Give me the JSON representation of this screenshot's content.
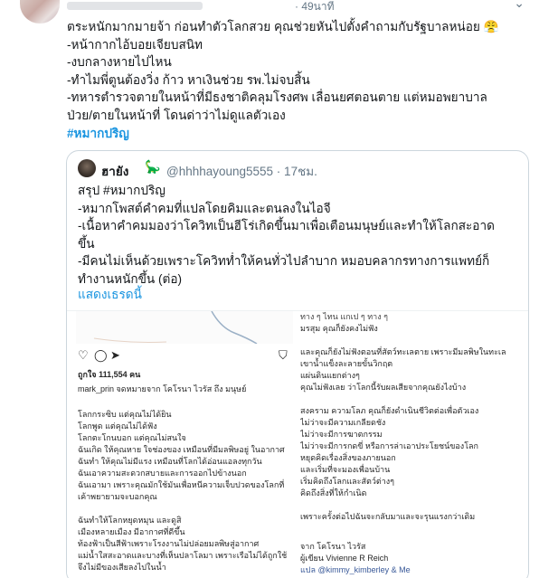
{
  "tweet": {
    "meta": "· 49นาที",
    "menu": "⌄",
    "lines": [
      "ตระหนักมากมายจ้า ก่อนทำตัวโลกสวย คุณช่วยหันไปตั้งคำถามกับรัฐบาลหน่อย 😤",
      "-หน้ากากไอ้บอยเจียบสนิท",
      "-งบกลางหายไปไหน",
      "-ทำไมพี่ตูนต้องวิ่ง ก้าว หาเงินช่วย รพ.ไม่จบสิ้น",
      "-ทหารตำรวจตายในหน้าที่มีธงชาติคลุมโรงศพ เลื่อนยศตอนตาย แต่หมอพยาบาล",
      "ป่วย/ตายในหน้าที่ โดนด่าว่าไม่ดูแลตัวเอง"
    ],
    "hashtag": "#หมากปริญ"
  },
  "quote": {
    "name": "ฮายัง",
    "emoji": "🦕",
    "handle_time": "@hhhhayoung5555 · 17ชม.",
    "lines": [
      "สรุป #หมากปริญ",
      "-หมากโพสต์คำคมที่แปลโดยคิมและตนลงในไอจี",
      "-เนื้อหาคำคมมองว่าโควิทเป็นฮีโร่เกิดขึ้นมาเพื่อเตือนมนุษย์และทำให้โลกสะอาด",
      "ขึ้น",
      "-มีคนไม่เห็นด้วยเพราะโควิทท่ำให้คนทั่วไปลำบาก หมอบคลากรทางการแพทย์ก็",
      "ทำงานหนักขึ้น (ต่อ)"
    ],
    "show_thread": "แสดงเธรดนี้"
  },
  "screenshot": {
    "likes": "ถูกใจ 111,554 คน",
    "by": "mark_prin จดหมายจาก โคโรนา ไวรัส ถึง มนุษย์",
    "poem_left": [
      "โลกกระซิบ แต่คุณไม่ได้ยิน",
      "โลกพูด แต่คุณไม่ได้ฟัง",
      "โลกตะโกนบอก แต่คุณไม่สนใจ",
      "ฉันเกิด ให้คุณหาย ใจช่องของ เหมือนที่มีมลพิษอยู่ ในอากาศ",
      "ฉันทำ ให้คุณไม่มีแรง เหมือนที่โลกได้อ่อนแอลงทุกวัน",
      "ฉันเอาความสะดวกสบายและการออกไปข้างนอก",
      "ฉันเอามา เพราะคุณมักใช้มันเพื่อหนีความเจ็บปวดของโลกที่",
      "เค้าพยายามจะบอกคุณ",
      "",
      "ฉันทำให้โลกหยุดหมุน และดูสิ",
      "เมืองหลายเมือง มีอากาศที่ดีขึ้น",
      "ท้องฟ้าเป็นสีฟ้าเพราะโรงงานไม่ปล่อยมลพิษสู่อากาศ",
      "แม่น้ำใสสะอาดและบางที่เห็นปลาโลมา เพราะเรือไม่ได้ถูกใช้",
      "จึงไม่มีของเสียลงไปในน้ำ"
    ],
    "poem_right": [
      "ทาง ๆ ไทน แกเป ๆ ทาง ๆ",
      "มรสุม คุณก็ยังคงไม่ฟัง",
      "",
      "และคุณก็ยังไม่ฟังตอนที่สัตว์ทะเลตาย เพราะมีมลพิษในทะเล",
      "เขาน้ำแข็งละลายขั้นวิกฤต",
      "แผ่นดินแยกต่างๆ",
      "คุณไม่ฟังเลย ว่าโลกนี้รับผลเสียจากคุณยังไงบ้าง",
      "",
      "สงคราม ความโลภ คุณก็ยังดำเนินชีวิตต่อเพื่อตัวเอง",
      "ไม่ว่าจะมีความเกลียดชัง",
      "ไม่ว่าจะมีการฆาตกรรม",
      "ไม่ว่าจะมีการกดขี่ หรือการล่าเอาประโยชน์ของโลก",
      "หยุดคิดเรื่องสิ่งของภายนอก",
      "และเริ่มที่จะมองเพื่อนบ้าน",
      "เริ่มคิดถึงโลกและสัตว์ต่างๆ",
      "คิดถึงสิ่งที่ให้กำเนิด",
      "",
      "เพราะครั้งต่อไปฉันจะกลับมาและจะรุนแรงกว่าเดิม"
    ],
    "credit_lines": [
      "จาก โคโรนา ไวรัส",
      "ผู้เขียน Vivienne R Reich",
      "แปล @kimmy_kimberley & Me"
    ]
  }
}
